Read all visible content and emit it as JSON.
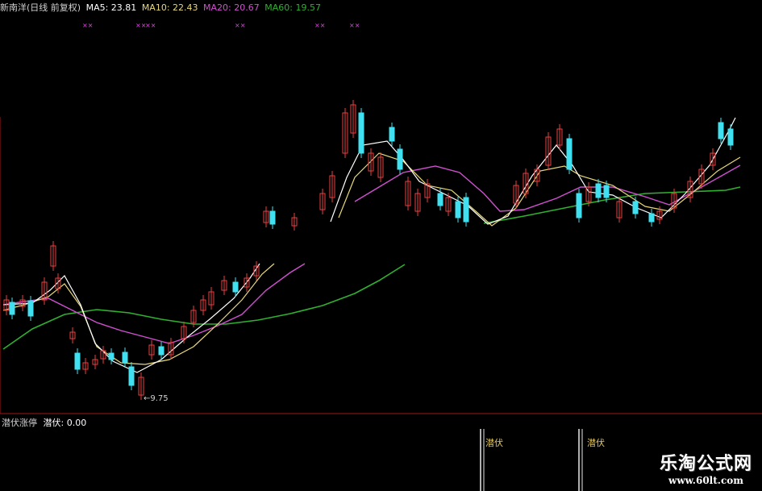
{
  "header": {
    "stock_name": "新南洋(日线 前复权)",
    "ma5_label": "MA5: 23.81",
    "ma10_label": "MA10: 22.43",
    "ma20_label": "MA20: 20.67",
    "ma60_label": "MA60: 19.57"
  },
  "indicator": {
    "name": "潜伏涨停",
    "value_label": "潜伏: 0.00",
    "signal1": "潜伏",
    "signal2": "潜伏"
  },
  "price_annotation": "9.75",
  "marker_text": "××",
  "watermark": {
    "title": "乐淘公式网",
    "url": "www.60lt.com"
  },
  "colors": {
    "up": "#e84040",
    "down": "#40e0f0",
    "ma5": "#ffffff",
    "ma10": "#e8d878",
    "ma20": "#d050d0",
    "ma60": "#30b030",
    "divider": "#a01818"
  }
}
